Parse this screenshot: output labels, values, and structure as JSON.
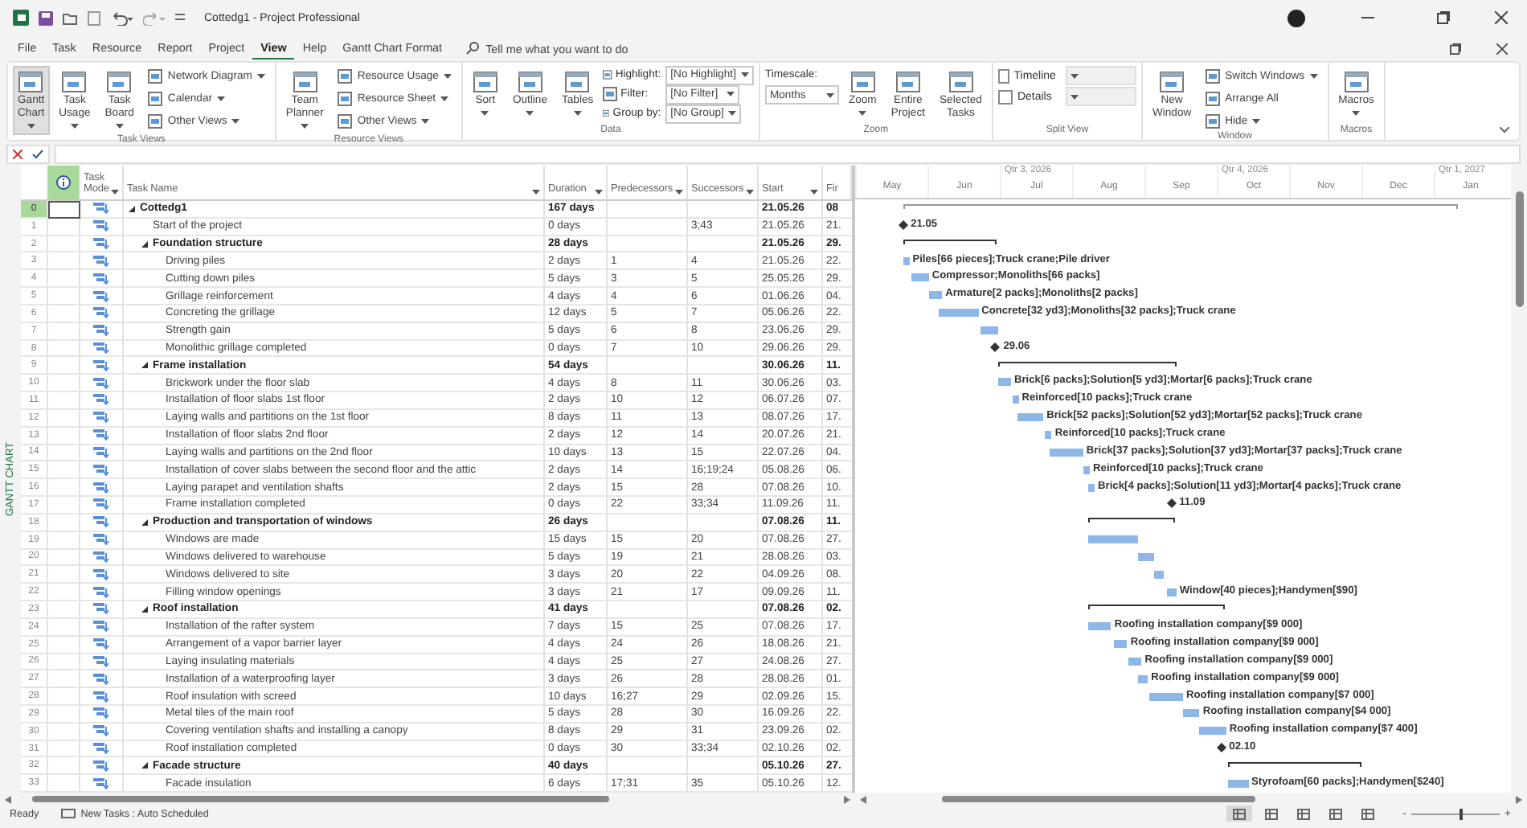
{
  "window": {
    "title": "Cottedg1 - Project Professional"
  },
  "menu": {
    "tabs": [
      {
        "label": "File",
        "selected": false
      },
      {
        "label": "Task",
        "selected": false
      },
      {
        "label": "Resource",
        "selected": false
      },
      {
        "label": "Report",
        "selected": false
      },
      {
        "label": "Project",
        "selected": false
      },
      {
        "label": "View",
        "selected": true
      },
      {
        "label": "Help",
        "selected": false
      },
      {
        "label": "Gantt Chart Format",
        "selected": false
      }
    ],
    "search": {
      "placeholder": "Tell me what you want to do"
    }
  },
  "ribbon": {
    "groups": [
      {
        "label": "Task Views",
        "items": [
          {
            "kind": "large",
            "label": "Gantt Chart",
            "dropdown": true,
            "selected": true
          },
          {
            "kind": "large",
            "label": "Task Usage",
            "dropdown": true,
            "selected": false
          },
          {
            "kind": "large",
            "label": "Task Board",
            "dropdown": true,
            "selected": false
          },
          {
            "kind": "small",
            "label": "Network Diagram",
            "dropdown": true,
            "selected": false
          },
          {
            "kind": "small",
            "label": "Calendar",
            "dropdown": true,
            "selected": false
          },
          {
            "kind": "small",
            "label": "Other Views",
            "dropdown": true,
            "selected": false
          }
        ]
      },
      {
        "label": "Resource Views",
        "items": [
          {
            "kind": "large",
            "label": "Team Planner",
            "dropdown": true,
            "selected": false
          },
          {
            "kind": "small",
            "label": "Resource Usage",
            "dropdown": true,
            "selected": false
          },
          {
            "kind": "small",
            "label": "Resource Sheet",
            "dropdown": true,
            "selected": false
          },
          {
            "kind": "small",
            "label": "Other Views",
            "dropdown": true,
            "selected": false
          }
        ]
      },
      {
        "label": "Data",
        "items": [
          {
            "kind": "large",
            "label": "Sort",
            "dropdown": true,
            "selected": false
          },
          {
            "kind": "large",
            "label": "Outline",
            "dropdown": true,
            "selected": false
          },
          {
            "kind": "large",
            "label": "Tables",
            "dropdown": true,
            "selected": false
          },
          {
            "kind": "field",
            "label": "Highlight:",
            "value": "[No Highlight]"
          },
          {
            "kind": "field",
            "label": "Filter:",
            "value": "[No Filter]"
          },
          {
            "kind": "field",
            "label": "Group by:",
            "value": "[No Group]"
          }
        ]
      },
      {
        "label": "Zoom",
        "items": [
          {
            "kind": "stacked_field",
            "label": "Timescale:",
            "value": "Months"
          },
          {
            "kind": "large",
            "label": "Zoom",
            "dropdown": true,
            "selected": false
          },
          {
            "kind": "large",
            "label": "Entire Project",
            "dropdown": false,
            "selected": false
          },
          {
            "kind": "large",
            "label": "Selected Tasks",
            "dropdown": false,
            "selected": false
          }
        ]
      },
      {
        "label": "Split View",
        "items": [
          {
            "kind": "check",
            "label": "Timeline",
            "checked": false
          },
          {
            "kind": "check",
            "label": "Details",
            "checked": false
          }
        ]
      },
      {
        "label": "Window",
        "items": [
          {
            "kind": "large",
            "label": "New Window",
            "dropdown": false,
            "selected": false
          },
          {
            "kind": "small",
            "label": "Switch Windows",
            "dropdown": true,
            "selected": false
          },
          {
            "kind": "small",
            "label": "Arrange All",
            "dropdown": false,
            "selected": false
          },
          {
            "kind": "small",
            "label": "Hide",
            "dropdown": true,
            "selected": false
          }
        ]
      },
      {
        "label": "Macros",
        "items": [
          {
            "kind": "large",
            "label": "Macros",
            "dropdown": true,
            "selected": false
          }
        ]
      }
    ]
  },
  "view_label": "GANTT CHART",
  "table": {
    "columns": [
      {
        "label": "Task Mode",
        "dropdown": true
      },
      {
        "label": "Task Name",
        "dropdown": true
      },
      {
        "label": "Duration",
        "dropdown": true
      },
      {
        "label": "Predecessors",
        "dropdown": true
      },
      {
        "label": "Successors",
        "dropdown": true
      },
      {
        "label": "Start",
        "dropdown": true
      },
      {
        "label": "Fir",
        "dropdown": false
      }
    ],
    "rows": [
      {
        "id": "0",
        "kind": "summary",
        "expanded": true,
        "selected": true,
        "name": "Cottedg1",
        "duration": "167 days",
        "start": "21.05.26",
        "finish": "08",
        "children": [
          {
            "id": "1",
            "kind": "milestone",
            "selected": false,
            "name": "Start of the project",
            "duration": "0 days",
            "successors": "3;43",
            "start": "21.05.26",
            "finish": "21.",
            "bar_label": "21.05"
          },
          {
            "id": "2",
            "kind": "summary",
            "expanded": true,
            "selected": false,
            "name": "Foundation structure",
            "duration": "28 days",
            "start": "21.05.26",
            "finish": "29.",
            "children": [
              {
                "id": "3",
                "kind": "task",
                "selected": false,
                "name": "Driving piles",
                "duration": "2 days",
                "predecessors": "1",
                "successors": "4",
                "start": "21.05.26",
                "finish": "22.",
                "bar_label": "Piles[66 pieces];Truck crane;Pile driver"
              },
              {
                "id": "4",
                "kind": "task",
                "selected": false,
                "name": "Cutting down piles",
                "duration": "5 days",
                "predecessors": "3",
                "successors": "5",
                "start": "25.05.26",
                "finish": "29.",
                "bar_label": "Compressor;Monoliths[66 packs]"
              },
              {
                "id": "5",
                "kind": "task",
                "selected": false,
                "name": "Grillage reinforcement",
                "duration": "4 days",
                "predecessors": "4",
                "successors": "6",
                "start": "01.06.26",
                "finish": "04.",
                "bar_label": "Armature[2 packs];Monoliths[2 packs]"
              },
              {
                "id": "6",
                "kind": "task",
                "selected": false,
                "name": "Concreting the grillage",
                "duration": "12 days",
                "predecessors": "5",
                "successors": "7",
                "start": "05.06.26",
                "finish": "22.",
                "bar_label": "Concrete[32 yd3];Monoliths[32 packs];Truck crane"
              },
              {
                "id": "7",
                "kind": "task",
                "selected": false,
                "name": "Strength gain",
                "duration": "5 days",
                "predecessors": "6",
                "successors": "8",
                "start": "23.06.26",
                "finish": "29."
              },
              {
                "id": "8",
                "kind": "milestone",
                "selected": false,
                "name": "Monolithic grillage completed",
                "duration": "0 days",
                "predecessors": "7",
                "successors": "10",
                "start": "29.06.26",
                "finish": "29.",
                "bar_label": "29.06"
              }
            ]
          },
          {
            "id": "9",
            "kind": "summary",
            "expanded": true,
            "selected": false,
            "name": "Frame installation",
            "duration": "54 days",
            "start": "30.06.26",
            "finish": "11.",
            "children": [
              {
                "id": "10",
                "kind": "task",
                "selected": false,
                "name": "Brickwork under the floor slab",
                "duration": "4 days",
                "predecessors": "8",
                "successors": "11",
                "start": "30.06.26",
                "finish": "03.",
                "bar_label": "Brick[6 packs];Solution[5 yd3];Mortar[6 packs];Truck crane"
              },
              {
                "id": "11",
                "kind": "task",
                "selected": false,
                "name": "Installation of floor slabs 1st floor",
                "duration": "2 days",
                "predecessors": "10",
                "successors": "12",
                "start": "06.07.26",
                "finish": "07.",
                "bar_label": "Reinforced[10 packs];Truck crane"
              },
              {
                "id": "12",
                "kind": "task",
                "selected": false,
                "name": "Laying walls and partitions on the 1st floor",
                "duration": "8 days",
                "predecessors": "11",
                "successors": "13",
                "start": "08.07.26",
                "finish": "17.",
                "bar_label": "Brick[52 packs];Solution[52 yd3];Mortar[52 packs];Truck crane"
              },
              {
                "id": "13",
                "kind": "task",
                "selected": false,
                "name": "Installation of floor slabs 2nd floor",
                "duration": "2 days",
                "predecessors": "12",
                "successors": "14",
                "start": "20.07.26",
                "finish": "21.",
                "bar_label": "Reinforced[10 packs];Truck crane"
              },
              {
                "id": "14",
                "kind": "task",
                "selected": false,
                "name": "Laying walls and partitions on the 2nd floor",
                "duration": "10 days",
                "predecessors": "13",
                "successors": "15",
                "start": "22.07.26",
                "finish": "04.",
                "bar_label": "Brick[37 packs];Solution[37 yd3];Mortar[37 packs];Truck crane"
              },
              {
                "id": "15",
                "kind": "task",
                "selected": false,
                "name": "Installation of cover slabs between the second floor and the attic",
                "duration": "2 days",
                "predecessors": "14",
                "successors": "16;19;24",
                "start": "05.08.26",
                "finish": "06.",
                "bar_label": "Reinforced[10 packs];Truck crane"
              },
              {
                "id": "16",
                "kind": "task",
                "selected": false,
                "name": "Laying parapet and ventilation shafts",
                "duration": "2 days",
                "predecessors": "15",
                "successors": "28",
                "start": "07.08.26",
                "finish": "10.",
                "bar_label": "Brick[4 packs];Solution[11 yd3];Mortar[4 packs];Truck crane"
              },
              {
                "id": "17",
                "kind": "milestone",
                "selected": false,
                "name": "Frame installation completed",
                "duration": "0 days",
                "predecessors": "22",
                "successors": "33;34",
                "start": "11.09.26",
                "finish": "11.",
                "bar_label": "11.09"
              }
            ]
          },
          {
            "id": "18",
            "kind": "summary",
            "expanded": true,
            "selected": false,
            "name": "Production and transportation of windows",
            "duration": "26 days",
            "start": "07.08.26",
            "finish": "11.",
            "children": [
              {
                "id": "19",
                "kind": "task",
                "selected": false,
                "name": "Windows are made",
                "duration": "15 days",
                "predecessors": "15",
                "successors": "20",
                "start": "07.08.26",
                "finish": "27."
              },
              {
                "id": "20",
                "kind": "task",
                "selected": false,
                "name": "Windows delivered to warehouse",
                "duration": "5 days",
                "predecessors": "19",
                "successors": "21",
                "start": "28.08.26",
                "finish": "03."
              },
              {
                "id": "21",
                "kind": "task",
                "selected": false,
                "name": "Windows delivered to site",
                "duration": "3 days",
                "predecessors": "20",
                "successors": "22",
                "start": "04.09.26",
                "finish": "08."
              },
              {
                "id": "22",
                "kind": "task",
                "selected": false,
                "name": "Filling window openings",
                "duration": "3 days",
                "predecessors": "21",
                "successors": "17",
                "start": "09.09.26",
                "finish": "11.",
                "bar_label": "Window[40 pieces];Handymen[$90]"
              }
            ]
          },
          {
            "id": "23",
            "kind": "summary",
            "expanded": true,
            "selected": false,
            "name": "Roof installation",
            "duration": "41 days",
            "start": "07.08.26",
            "finish": "02.",
            "children": [
              {
                "id": "24",
                "kind": "task",
                "selected": false,
                "name": "Installation of the rafter system",
                "duration": "7 days",
                "predecessors": "15",
                "successors": "25",
                "start": "07.08.26",
                "finish": "17.",
                "bar_label": "Roofing installation company[$9 000]"
              },
              {
                "id": "25",
                "kind": "task",
                "selected": false,
                "name": "Arrangement of a vapor barrier layer",
                "duration": "4 days",
                "predecessors": "24",
                "successors": "26",
                "start": "18.08.26",
                "finish": "21.",
                "bar_label": "Roofing installation company[$9 000]"
              },
              {
                "id": "26",
                "kind": "task",
                "selected": false,
                "name": "Laying insulating materials",
                "duration": "4 days",
                "predecessors": "25",
                "successors": "27",
                "start": "24.08.26",
                "finish": "27.",
                "bar_label": "Roofing installation company[$9 000]"
              },
              {
                "id": "27",
                "kind": "task",
                "selected": false,
                "name": "Installation of a waterproofing layer",
                "duration": "3 days",
                "predecessors": "26",
                "successors": "28",
                "start": "28.08.26",
                "finish": "01.",
                "bar_label": "Roofing installation company[$9 000]"
              },
              {
                "id": "28",
                "kind": "task",
                "selected": false,
                "name": "Roof insulation with screed",
                "duration": "10 days",
                "predecessors": "16;27",
                "successors": "29",
                "start": "02.09.26",
                "finish": "15.",
                "bar_label": "Roofing installation company[$7 000]"
              },
              {
                "id": "29",
                "kind": "task",
                "selected": false,
                "name": "Metal tiles of the main roof",
                "duration": "5 days",
                "predecessors": "28",
                "successors": "30",
                "start": "16.09.26",
                "finish": "22.",
                "bar_label": "Roofing installation company[$4 000]"
              },
              {
                "id": "30",
                "kind": "task",
                "selected": false,
                "name": "Covering ventilation shafts and installing a canopy",
                "duration": "8 days",
                "predecessors": "29",
                "successors": "31",
                "start": "23.09.26",
                "finish": "02.",
                "bar_label": "Roofing installation company[$7 400]"
              },
              {
                "id": "31",
                "kind": "milestone",
                "selected": false,
                "name": "Roof installation completed",
                "duration": "0 days",
                "predecessors": "30",
                "successors": "33;34",
                "start": "02.10.26",
                "finish": "02.",
                "bar_label": "02.10"
              }
            ]
          },
          {
            "id": "32",
            "kind": "summary",
            "expanded": true,
            "selected": false,
            "name": "Facade structure",
            "duration": "40 days",
            "start": "05.10.26",
            "finish": "27.",
            "children": [
              {
                "id": "33",
                "kind": "task",
                "selected": false,
                "name": "Facade insulation",
                "duration": "6 days",
                "predecessors": "17;31",
                "successors": "35",
                "start": "05.10.26",
                "finish": "12.",
                "bar_label": "Styrofoam[60 packs];Handymen[$240]"
              }
            ]
          }
        ]
      }
    ]
  },
  "timescale": {
    "months": [
      {
        "label": "May"
      },
      {
        "label": "Jun"
      },
      {
        "label": "Jul",
        "quarter": "Qtr 3, 2026"
      },
      {
        "label": "Aug"
      },
      {
        "label": "Sep"
      },
      {
        "label": "Oct",
        "quarter": "Qtr 4, 2026"
      },
      {
        "label": "Nov"
      },
      {
        "label": "Dec"
      },
      {
        "label": "Jan",
        "quarter": "Qtr 1, 2027"
      }
    ]
  },
  "status_bar": {
    "ready": "Ready",
    "new_tasks": "New Tasks : Auto Scheduled",
    "views": [
      {
        "selected": true
      },
      {
        "selected": false
      },
      {
        "selected": false
      },
      {
        "selected": false
      },
      {
        "selected": false
      }
    ],
    "zoom": {
      "minus": "-",
      "plus": "+",
      "level": 0.55
    }
  }
}
